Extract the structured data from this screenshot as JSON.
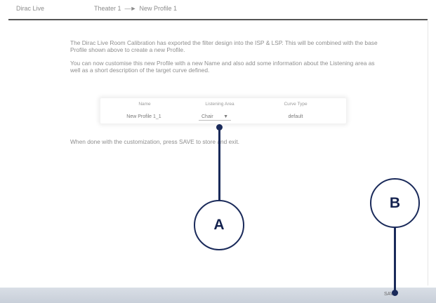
{
  "header": {
    "app_name": "Dirac Live",
    "breadcrumb": {
      "parent": "Theater 1",
      "arrow": "—►",
      "current": "New Profile 1"
    }
  },
  "main": {
    "intro_paragraph_1": "The Dirac Live Room Calibration has exported the filter design into the ISP & LSP. This will be combined with the base Profile shown above to create a new Profile.",
    "intro_paragraph_2": "You can now customise this new Profile with a new Name and also add some information about the Listening area as well as a short description of the target curve defined.",
    "profile_table": {
      "headers": {
        "name": "Name",
        "listening_area": "Listening Area",
        "curve_type": "Curve Type"
      },
      "name_value": "New Profile 1_1",
      "listening_area_value": "Chair",
      "listening_area_arrow": "▼",
      "curve_type_value": "default"
    },
    "done_text": "When done with the customization, press SAVE to store and exit."
  },
  "footer": {
    "save_label": "SAVE"
  },
  "annotations": {
    "callout_a": "A",
    "callout_b": "B",
    "color": "#1a2a5a"
  }
}
